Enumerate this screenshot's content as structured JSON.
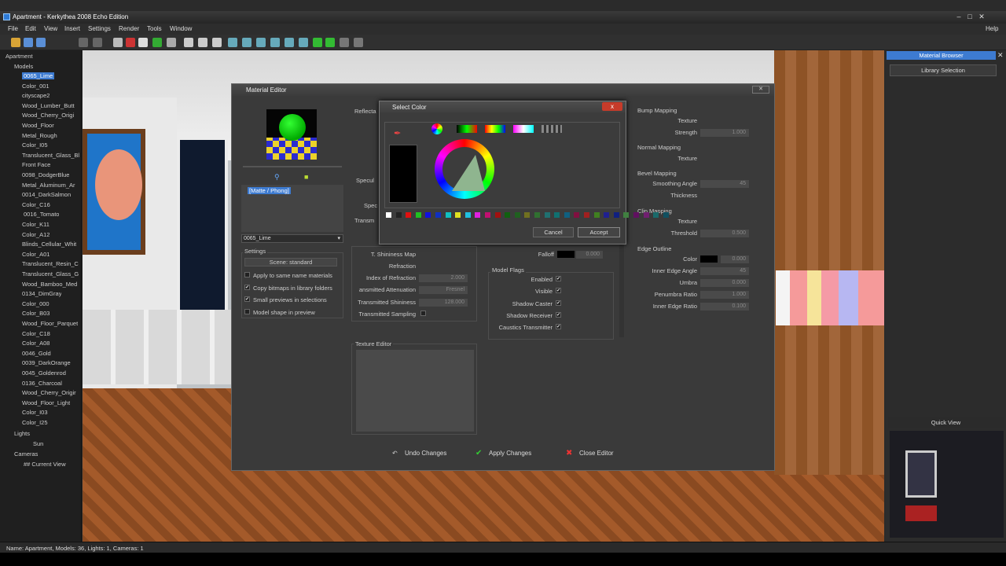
{
  "window": {
    "title": "Apartment - Kerkythea 2008 Echo Edition"
  },
  "menu": [
    "File",
    "Edit",
    "View",
    "Insert",
    "Settings",
    "Render",
    "Tools",
    "Window"
  ],
  "menu_help": "Help",
  "outliner": {
    "root": "Apartment",
    "models_label": "Models",
    "models": [
      "0065_Lime",
      "Color_001",
      "cityscape2",
      "Wood_Lumber_Butt",
      "Wood_Cherry_Origi",
      "Wood_Floor",
      "Metal_Rough",
      "Color_I05",
      "Translucent_Glass_Bl",
      "Front Face",
      "0098_DodgerBlue",
      "Metal_Aluminum_Ar",
      "0014_DarkSalmon",
      "Color_C16",
      "0016_Tomato",
      "Color_K11",
      "Color_A12",
      "Blinds_Cellular_Whit",
      "Color_A01",
      "Translucent_Resin_C",
      "Translucent_Glass_G",
      "Wood_Bamboo_Med",
      "0134_DimGray",
      "Color_000",
      "Color_B03",
      "Wood_Floor_Parquet",
      "Color_C18",
      "Color_A08",
      "0046_Gold",
      "0039_DarkOrange",
      "0045_Goldenrod",
      "0136_Charcoal",
      "Wood_Cherry_Origir",
      "Wood_Floor_Light",
      "Color_I03",
      "Color_I25"
    ],
    "lights_label": "Lights",
    "lights": [
      "Sun"
    ],
    "cameras_label": "Cameras",
    "cameras": [
      "## Current View"
    ]
  },
  "sidebar": {
    "header": "Material Browser",
    "library_button": "Library Selection",
    "quick_view": "Quick View"
  },
  "status": "Name: Apartment, Models: 36, Lights: 1, Cameras: 1",
  "material_editor": {
    "title": "Material Editor",
    "material_type": "[Matte / Phong]",
    "material_select": "0065_Lime",
    "settings_label": "Settings",
    "scene_label": "Scene: standard",
    "options": [
      {
        "label": "Apply to same name materials",
        "checked": false
      },
      {
        "label": "Copy bitmaps in library folders",
        "checked": true
      },
      {
        "label": "Small previews in selections",
        "checked": true
      },
      {
        "label": "Model shape in preview",
        "checked": false
      }
    ],
    "partial_labels": {
      "reflecta": "Reflecta",
      "specul": "Specul",
      "spec": "Spec",
      "transm": "Transm"
    },
    "t_shininess_map": "T. Shininess Map",
    "refraction": "Refraction",
    "index_of_refraction": {
      "label": "Index of Refraction",
      "value": "2.000"
    },
    "transmitted_attenuation": {
      "label": "ansmitted Attenuation",
      "value": "Fresnel"
    },
    "transmitted_shininess": {
      "label": "Transmitted Shininess",
      "value": "128.000"
    },
    "transmitted_sampling": "Transmitted Sampling",
    "falloff": {
      "label": "Falloff",
      "value": "0.000"
    },
    "model_flags": {
      "label": "Model Flags",
      "items": [
        "Enabled",
        "Visible",
        "Shadow Caster",
        "Shadow Receiver",
        "Caustics Transmitter"
      ]
    },
    "texture_editor": "Texture Editor",
    "bump_mapping": {
      "label": "Bump Mapping",
      "texture": "Texture",
      "strength_label": "Strength",
      "strength": "1.000"
    },
    "normal_mapping": {
      "label": "Normal Mapping",
      "texture": "Texture"
    },
    "bevel_mapping": {
      "label": "Bevel Mapping",
      "smoothing_label": "Smoothing Angle",
      "smoothing": "45",
      "thickness_label": "Thickness"
    },
    "clip_mapping": {
      "label": "Clip Mapping",
      "texture": "Texture",
      "threshold_label": "Threshold",
      "threshold": "0.500"
    },
    "edge_outline": {
      "label": "Edge Outline",
      "color_label": "Color",
      "color_value": "0.000",
      "inner_edge_label": "Inner Edge Angle",
      "inner_edge": "45",
      "umbra_label": "Umbra",
      "umbra": "0.000",
      "penumbra_label": "Penumbra Ratio",
      "penumbra": "1.000",
      "inner_ratio_label": "Inner Edge Ratio",
      "inner_ratio": "0.100"
    },
    "undo": "Undo Changes",
    "apply": "Apply Changes",
    "close": "Close Editor"
  },
  "select_color": {
    "title": "Select Color",
    "close": "x",
    "cancel": "Cancel",
    "accept": "Accept",
    "swatches": [
      "#ffffff",
      "#222222",
      "#e01010",
      "#20c020",
      "#1010e0",
      "#1030c0",
      "#10c0c0",
      "#e0e020",
      "#20c0e0",
      "#e020e0",
      "#c01070",
      "#a01010",
      "#106010",
      "#206020",
      "#707020",
      "#307030",
      "#207070",
      "#107070",
      "#106080",
      "#801040",
      "#a02020",
      "#408020",
      "#202090",
      "#102080",
      "#408040",
      "#601060",
      "#702070",
      "#1a6a6a",
      "#105060"
    ],
    "accent": "#3d7bd1"
  }
}
